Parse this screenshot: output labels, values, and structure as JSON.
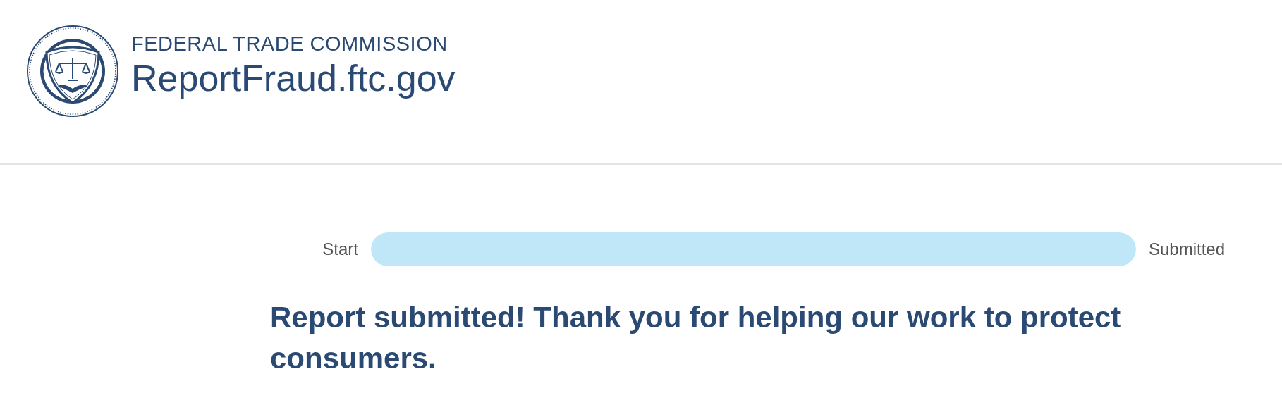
{
  "header": {
    "agency": "FEDERAL TRADE COMMISSION",
    "site": "ReportFraud.ftc.gov"
  },
  "progress": {
    "start_label": "Start",
    "end_label": "Submitted",
    "level": 1
  },
  "message": "Report submitted! Thank you for helping our work to protect consumers."
}
